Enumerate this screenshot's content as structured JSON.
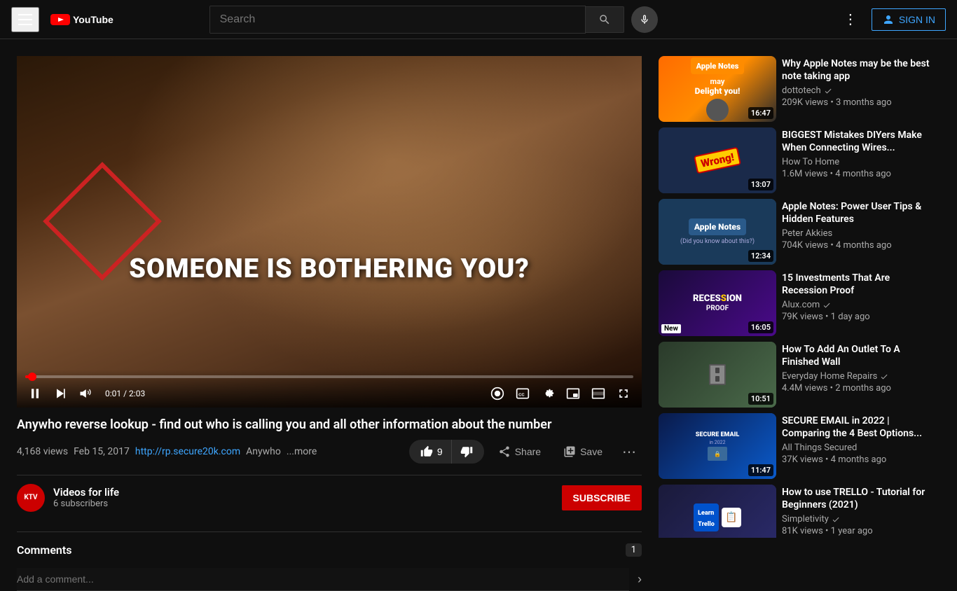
{
  "header": {
    "hamburger_label": "Menu",
    "logo_text": "YouTube",
    "search_placeholder": "Search",
    "sign_in_label": "SIGN IN"
  },
  "video": {
    "title": "Anywho reverse lookup - find out who is calling you and all other information about the number",
    "views": "4,168 views",
    "date": "Feb 15, 2017",
    "url": "http://rp.secure20k.com",
    "url_text": "http://rp.secure20k.com",
    "channel_tag": "Anywho",
    "more_text": "...more",
    "overlay_text": "SOMEONE IS BOTHERING YOU?",
    "time_current": "0:01",
    "time_total": "2:03",
    "like_count": "9",
    "dislike_label": "Dislike",
    "share_label": "Share",
    "save_label": "Save"
  },
  "channel": {
    "name": "Videos for life",
    "subscribers": "6 subscribers",
    "avatar_letter": "KTV",
    "subscribe_label": "SUBSCRIBE"
  },
  "comments": {
    "label": "Comments",
    "count": "1",
    "placeholder": "Add a comment..."
  },
  "sidebar": {
    "items": [
      {
        "id": 1,
        "title": "Why Apple Notes may be the best note taking app",
        "channel": "dottotech",
        "verified": true,
        "views": "209K views",
        "age": "3 months ago",
        "duration": "16:47",
        "thumb_class": "thumb-1",
        "new_badge": false
      },
      {
        "id": 2,
        "title": "BIGGEST Mistakes DIYers Make When Connecting Wires...",
        "channel": "How To Home",
        "verified": false,
        "views": "1.6M views",
        "age": "4 months ago",
        "duration": "13:07",
        "thumb_class": "thumb-2",
        "new_badge": false
      },
      {
        "id": 3,
        "title": "Apple Notes: Power User Tips & Hidden Features",
        "channel": "Peter Akkies",
        "verified": false,
        "views": "704K views",
        "age": "4 months ago",
        "duration": "12:34",
        "thumb_class": "thumb-3",
        "new_badge": false
      },
      {
        "id": 4,
        "title": "15 Investments That Are Recession Proof",
        "channel": "Alux.com",
        "verified": true,
        "views": "79K views",
        "age": "1 day ago",
        "duration": "16:05",
        "thumb_class": "thumb-4",
        "new_badge": true
      },
      {
        "id": 5,
        "title": "How To Add An Outlet To A Finished Wall",
        "channel": "Everyday Home Repairs",
        "verified": true,
        "views": "4.4M views",
        "age": "2 months ago",
        "duration": "10:51",
        "thumb_class": "thumb-5",
        "new_badge": false
      },
      {
        "id": 6,
        "title": "SECURE EMAIL in 2022 | Comparing the 4 Best Options...",
        "channel": "All Things Secured",
        "verified": false,
        "views": "37K views",
        "age": "4 months ago",
        "duration": "11:47",
        "thumb_class": "thumb-6",
        "new_badge": false
      },
      {
        "id": 7,
        "title": "How to use TRELLO - Tutorial for Beginners (2021)",
        "channel": "Simpletivity",
        "verified": true,
        "views": "81K views",
        "age": "1 year ago",
        "duration": "",
        "thumb_class": "thumb-7",
        "new_badge": false
      }
    ]
  }
}
